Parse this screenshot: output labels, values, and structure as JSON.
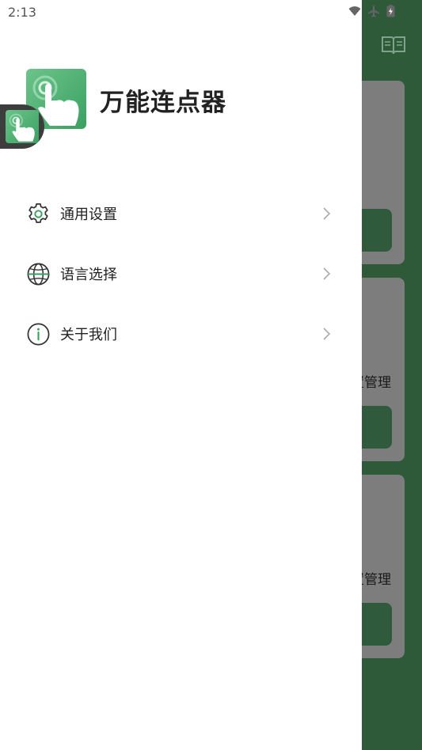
{
  "status_bar": {
    "time": "2:13"
  },
  "app": {
    "title": "万能连点器"
  },
  "menu": {
    "items": [
      {
        "label": "通用设置",
        "icon": "gear-icon"
      },
      {
        "label": "语言选择",
        "icon": "globe-icon"
      },
      {
        "label": "关于我们",
        "icon": "info-icon"
      }
    ]
  },
  "background": {
    "cards": [
      {
        "label": ""
      },
      {
        "label": "置管理"
      },
      {
        "label": "置管理"
      }
    ]
  },
  "colors": {
    "accent": "#3aa062",
    "background_app": "#2e5a3a"
  }
}
